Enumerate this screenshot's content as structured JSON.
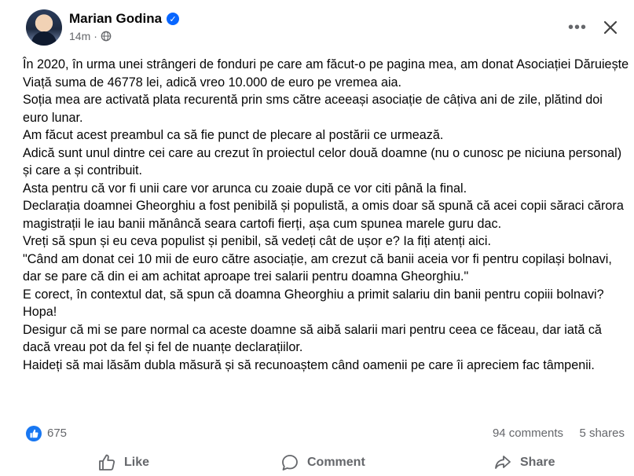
{
  "post": {
    "author": "Marian Godina",
    "time": "14m",
    "separator": "·",
    "paragraphs": [
      "În 2020, în urma unei strângeri de fonduri pe care am făcut-o pe pagina mea, am donat Asociației Dăruiește Viață suma de 46778 lei, adică vreo 10.000 de euro pe vremea aia.",
      "Soția mea are activată plata recurentă prin sms către aceeași asociație de câțiva ani de zile, plătind doi euro lunar.",
      "Am făcut acest preambul ca să fie punct de plecare al postării ce urmează.",
      "Adică sunt unul dintre cei care au crezut în proiectul celor două doamne (nu o cunosc pe niciuna personal) și care a și contribuit.",
      "Asta pentru că vor fi unii care vor arunca cu zoaie după ce vor citi până la final.",
      "Declarația doamnei Gheorghiu a fost penibilă și populistă, a omis doar să spună că acei copii săraci cărora magistrații le iau banii mănâncă seara cartofi fierți, așa cum spunea marele guru dac.",
      "Vreți să spun și eu ceva populist și penibil, să vedeți cât de ușor e? Ia fiți atenți aici.",
      "\"Când am donat cei 10 mii de euro către asociație, am crezut că banii aceia vor fi pentru copilași bolnavi, dar se pare că din ei am achitat aproape trei salarii pentru doamna Gheorghiu.\"",
      "E corect, în contextul dat, să spun că doamna Gheorghiu a primit salariu din banii pentru copiii bolnavi?",
      "Hopa!",
      "Desigur că mi se pare normal ca aceste doamne să aibă salarii mari pentru ceea ce făceau, dar iată că dacă vreau pot da fel și fel de nuanțe declarațiilor.",
      "Haideți să mai lăsăm dubla măsură și să recunoaștem când oamenii pe care îi apreciem fac tâmpenii."
    ]
  },
  "stats": {
    "reactions": "675",
    "comments": "94 comments",
    "shares": "5 shares"
  },
  "actions": {
    "like": "Like",
    "comment": "Comment",
    "share": "Share"
  },
  "icons": {
    "verified": "verified-badge-icon",
    "globe": "globe-icon",
    "more": "more-options-icon",
    "close": "close-icon",
    "like": "thumbs-up-icon",
    "comment": "comment-bubble-icon",
    "share": "share-arrow-icon"
  },
  "colors": {
    "accent": "#0866ff",
    "like_blue": "#1877f2",
    "secondary_text": "#65676b"
  }
}
